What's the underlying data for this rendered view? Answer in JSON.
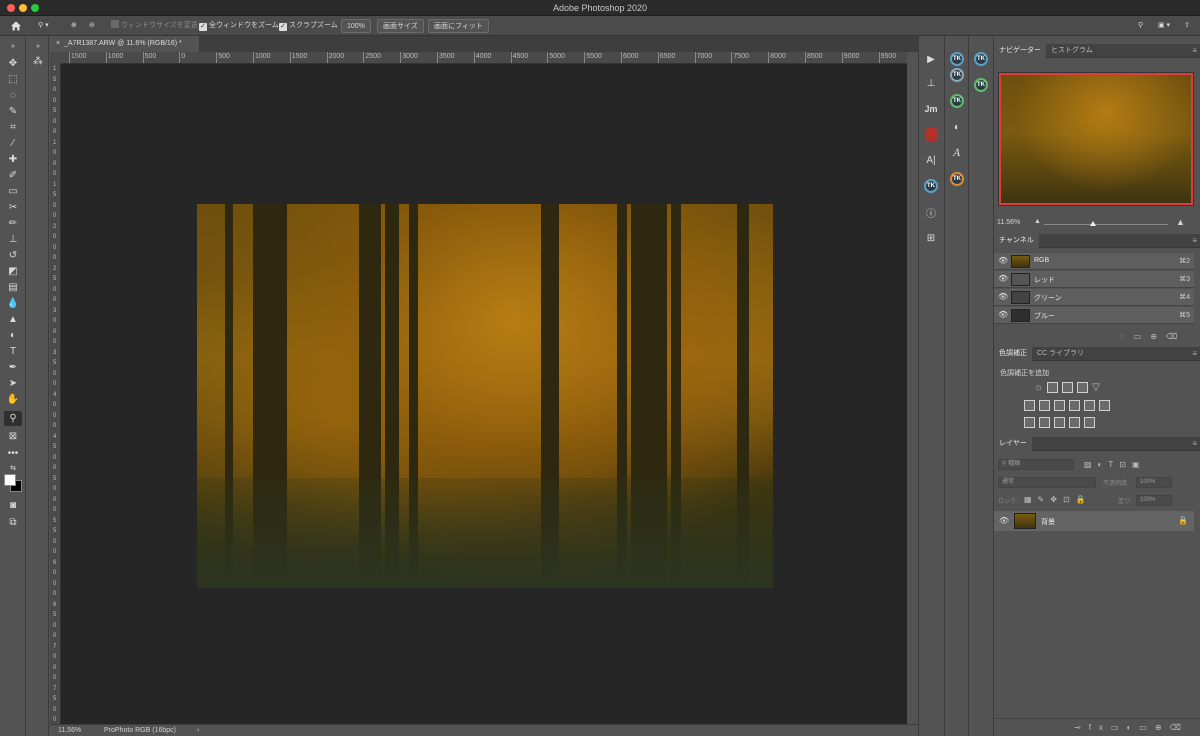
{
  "window": {
    "title": "Adobe Photoshop 2020"
  },
  "options_bar": {
    "resize_windows": "ウィンドウサイズを変更",
    "zoom_all_windows": "全ウィンドウをズーム",
    "scrubby_zoom": "スクラブズーム",
    "zoom_value": "100%",
    "fit_screen": "画面サイズ",
    "fill_screen": "画面にフィット"
  },
  "document": {
    "tab_title": "_A7R1387.ARW @ 11.6% (RGB/16) *",
    "zoom": "11.56%",
    "color_profile": "ProPhoto RGB (16bpc)"
  },
  "ruler": {
    "h_ticks": [
      "1500",
      "1000",
      "500",
      "0",
      "500",
      "1000",
      "1500",
      "2000",
      "2500",
      "3000",
      "3500",
      "4000",
      "4500",
      "5000",
      "5500",
      "6000",
      "6500",
      "7000",
      "7500",
      "8000",
      "8500",
      "9000",
      "9500"
    ],
    "v_ticks": [
      "1",
      "5",
      "0",
      "0",
      "5",
      "0",
      "0",
      "1",
      "0",
      "0",
      "0",
      "1",
      "5",
      "0",
      "0",
      "2",
      "0",
      "0",
      "0",
      "2",
      "5",
      "0",
      "0",
      "3",
      "0",
      "0",
      "0",
      "3",
      "5",
      "0",
      "0",
      "4",
      "0",
      "0",
      "0",
      "4",
      "5",
      "0",
      "0",
      "5",
      "0",
      "0",
      "0",
      "5",
      "5",
      "0",
      "0",
      "6",
      "0",
      "0",
      "0",
      "6",
      "5",
      "0",
      "0",
      "7",
      "0",
      "0",
      "0",
      "7",
      "5",
      "0",
      "0"
    ]
  },
  "navigator": {
    "tab_navigator": "ナビゲーター",
    "tab_histogram": "ヒストグラム",
    "zoom": "11.56%"
  },
  "channels": {
    "tab": "チャンネル",
    "rows": [
      {
        "name": "RGB",
        "shortcut": "⌘2"
      },
      {
        "name": "レッド",
        "shortcut": "⌘3"
      },
      {
        "name": "グリーン",
        "shortcut": "⌘4"
      },
      {
        "name": "ブルー",
        "shortcut": "⌘5"
      }
    ]
  },
  "adjustments": {
    "tab_adjust": "色調補正",
    "tab_library": "CC ライブラリ",
    "add_label": "色調補正を追加"
  },
  "layers": {
    "tab": "レイヤー",
    "filter_kind": "種類",
    "blend_mode": "通常",
    "opacity_label": "不透明度:",
    "opacity_value": "100%",
    "lock_label": "ロック:",
    "fill_label": "塗り:",
    "fill_value": "100%",
    "layer_name": "背景"
  },
  "toolbar_icons": [
    "move-icon",
    "marquee-icon",
    "lasso-icon",
    "quick-select-icon",
    "crop-icon",
    "eyedropper-icon",
    "healing-icon",
    "brush-icon",
    "stamp-icon",
    "history-brush-icon",
    "eraser-icon",
    "gradient-icon",
    "blur-icon",
    "dodge-icon",
    "pen-icon",
    "type-icon",
    "path-select-icon",
    "shape-icon",
    "hand-icon",
    "zoom-icon",
    "edit-toolbar-icon"
  ]
}
